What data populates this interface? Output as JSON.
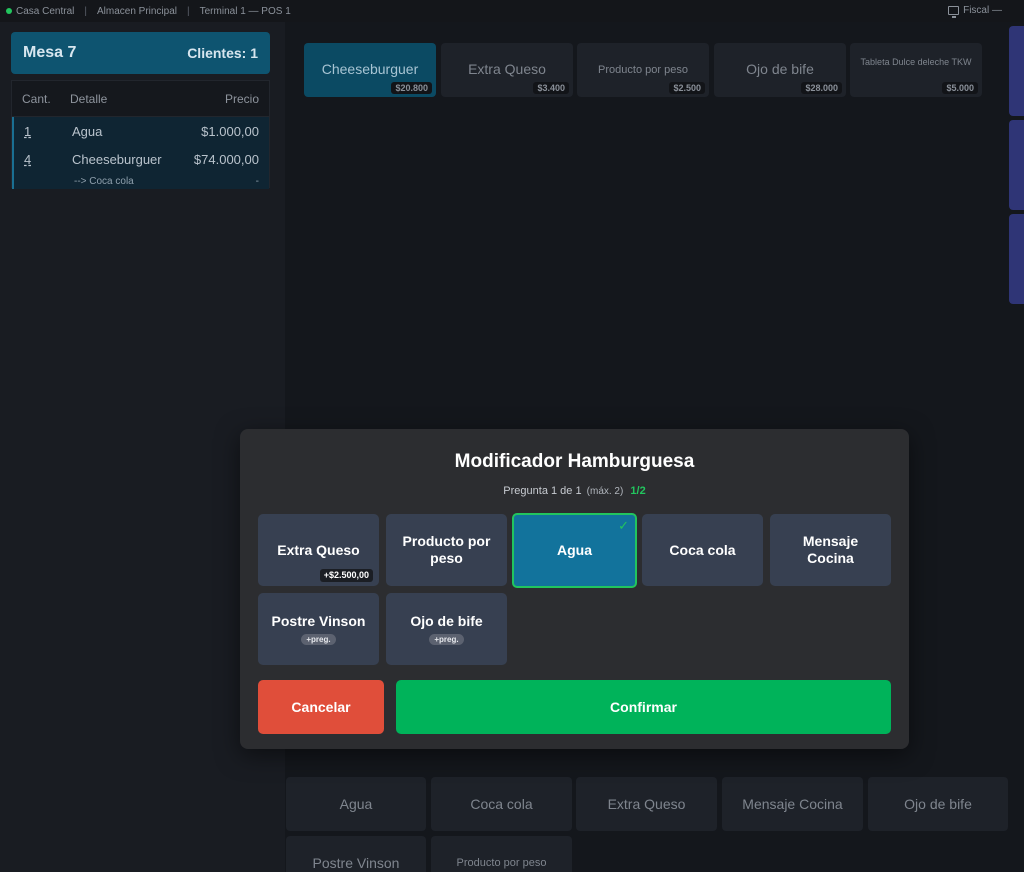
{
  "topbar": {
    "branch": "Casa Central",
    "warehouse": "Almacen Principal",
    "terminal": "Terminal 1 — POS 1",
    "fiscal": "Fiscal —",
    "status_color": "#22c55e"
  },
  "order": {
    "table_name": "Mesa 7",
    "clients": "Clientes: 1",
    "headers": {
      "qty": "Cant.",
      "detail": "Detalle",
      "price": "Precio"
    },
    "rows": [
      {
        "qty": "1",
        "detail": "Agua",
        "price": "$1.000,00"
      },
      {
        "qty": "4",
        "detail": "Cheeseburguer",
        "price": "$74.000,00",
        "sub_detail": "--> Coca cola",
        "sub_price": "-"
      }
    ]
  },
  "products": [
    {
      "name": "Cheeseburguer",
      "price": "$20.800"
    },
    {
      "name": "Extra Queso",
      "price": "$3.400"
    },
    {
      "name": "Producto por peso",
      "price": "$2.500"
    },
    {
      "name": "Ojo de bife",
      "price": "$28.000"
    },
    {
      "name": "Tableta Dulce deleche TKW",
      "price": "$5.000"
    }
  ],
  "bottom_products": [
    "Agua",
    "Coca cola",
    "Extra Queso",
    "Mensaje Cocina",
    "Ojo de bife",
    "Postre Vinson",
    "Producto por peso"
  ],
  "modal": {
    "title": "Modificador Hamburguesa",
    "question": "Pregunta 1 de 1",
    "max": "(máx. 2)",
    "count": "1/2",
    "options": [
      {
        "label": "Extra Queso",
        "price": "+$2.500,00"
      },
      {
        "label": "Producto por peso"
      },
      {
        "label": "Agua",
        "selected": true,
        "check": "✓"
      },
      {
        "label": "Coca cola"
      },
      {
        "label": "Mensaje Cocina"
      },
      {
        "label": "Postre Vinson",
        "badge": "+preg."
      },
      {
        "label": "Ojo de bife",
        "badge": "+preg."
      }
    ],
    "cancel": "Cancelar",
    "confirm": "Confirmar"
  },
  "colors": {
    "accent": "#0e5470",
    "confirm": "#00b35a",
    "cancel": "#e04e3a",
    "selected": "#12739c",
    "edge_strip": "#2f3576"
  }
}
